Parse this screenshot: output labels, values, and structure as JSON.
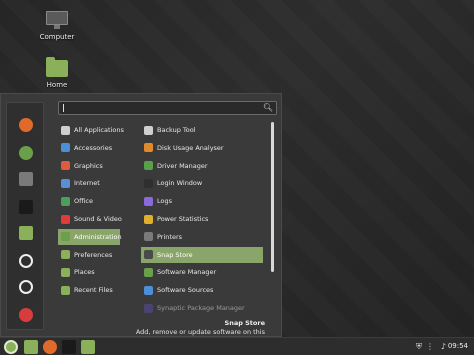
{
  "desktop": {
    "icons": [
      {
        "label": "Computer",
        "icon": "computer-icon"
      },
      {
        "label": "Home",
        "icon": "folder-icon"
      }
    ]
  },
  "menu": {
    "search": {
      "placeholder": "",
      "value": ""
    },
    "categories": [
      {
        "label": "All Applications",
        "icon": "grid-icon",
        "color": "#cfcfcf"
      },
      {
        "label": "Accessories",
        "icon": "accessories-icon",
        "color": "#4a8fd8"
      },
      {
        "label": "Graphics",
        "icon": "graphics-icon",
        "color": "#e05a3c"
      },
      {
        "label": "Internet",
        "icon": "internet-icon",
        "color": "#5a8fd8"
      },
      {
        "label": "Office",
        "icon": "office-icon",
        "color": "#4aa05a"
      },
      {
        "label": "Sound & Video",
        "icon": "media-icon",
        "color": "#e03c3c"
      },
      {
        "label": "Administration",
        "icon": "admin-icon",
        "color": "#6aa04a"
      },
      {
        "label": "Preferences",
        "icon": "preferences-icon",
        "color": "#8bb05a"
      },
      {
        "label": "Places",
        "icon": "folder-icon",
        "color": "#8bb05a"
      },
      {
        "label": "Recent Files",
        "icon": "folder-icon",
        "color": "#8bb05a"
      }
    ],
    "selected_category": "Administration",
    "apps": [
      {
        "label": "Backup Tool",
        "icon": "backup-icon",
        "color": "#cfcfcf"
      },
      {
        "label": "Disk Usage Analyser",
        "icon": "disk-usage-icon",
        "color": "#e08a2c"
      },
      {
        "label": "Driver Manager",
        "icon": "driver-icon",
        "color": "#5aa04a"
      },
      {
        "label": "Login Window",
        "icon": "login-icon",
        "color": "#2f2f2f"
      },
      {
        "label": "Logs",
        "icon": "logs-icon",
        "color": "#8a6ad8"
      },
      {
        "label": "Power Statistics",
        "icon": "power-stats-icon",
        "color": "#e0b02c"
      },
      {
        "label": "Printers",
        "icon": "printer-icon",
        "color": "#7a7a7a"
      },
      {
        "label": "Snap Store",
        "icon": "snap-icon",
        "color": "#4a4a4a"
      },
      {
        "label": "Software Manager",
        "icon": "software-manager-icon",
        "color": "#6aa04a"
      },
      {
        "label": "Software Sources",
        "icon": "software-sources-icon",
        "color": "#4a8fd8"
      },
      {
        "label": "Synaptic Package Manager",
        "icon": "synaptic-icon",
        "color": "#5a4a9a",
        "dim": true
      }
    ],
    "selected_app": "Snap Store",
    "description": {
      "title": "Snap Store",
      "text": "Add, remove or update software on this computer"
    },
    "favorites": [
      {
        "name": "firefox-icon",
        "color": "#e06a2c"
      },
      {
        "name": "software-manager-icon",
        "color": "#6aa04a"
      },
      {
        "name": "settings-icon",
        "color": "#7a7a7a"
      },
      {
        "name": "terminal-icon",
        "color": "#1a1a1a"
      },
      {
        "name": "files-icon",
        "color": "#8bb05a"
      },
      {
        "name": "lock-icon",
        "color": "#2f2f2f"
      },
      {
        "name": "logout-icon",
        "color": "#2f2f2f"
      },
      {
        "name": "shutdown-icon",
        "color": "#d83c3c"
      }
    ]
  },
  "panel": {
    "launchers": [
      {
        "name": "menu-icon",
        "color": "#8bb05a"
      },
      {
        "name": "files-icon",
        "color": "#8bb05a"
      },
      {
        "name": "firefox-icon",
        "color": "#e06a2c"
      },
      {
        "name": "terminal-icon",
        "color": "#1a1a1a"
      },
      {
        "name": "folder-icon",
        "color": "#8bb05a"
      }
    ],
    "clock": "09:54"
  }
}
